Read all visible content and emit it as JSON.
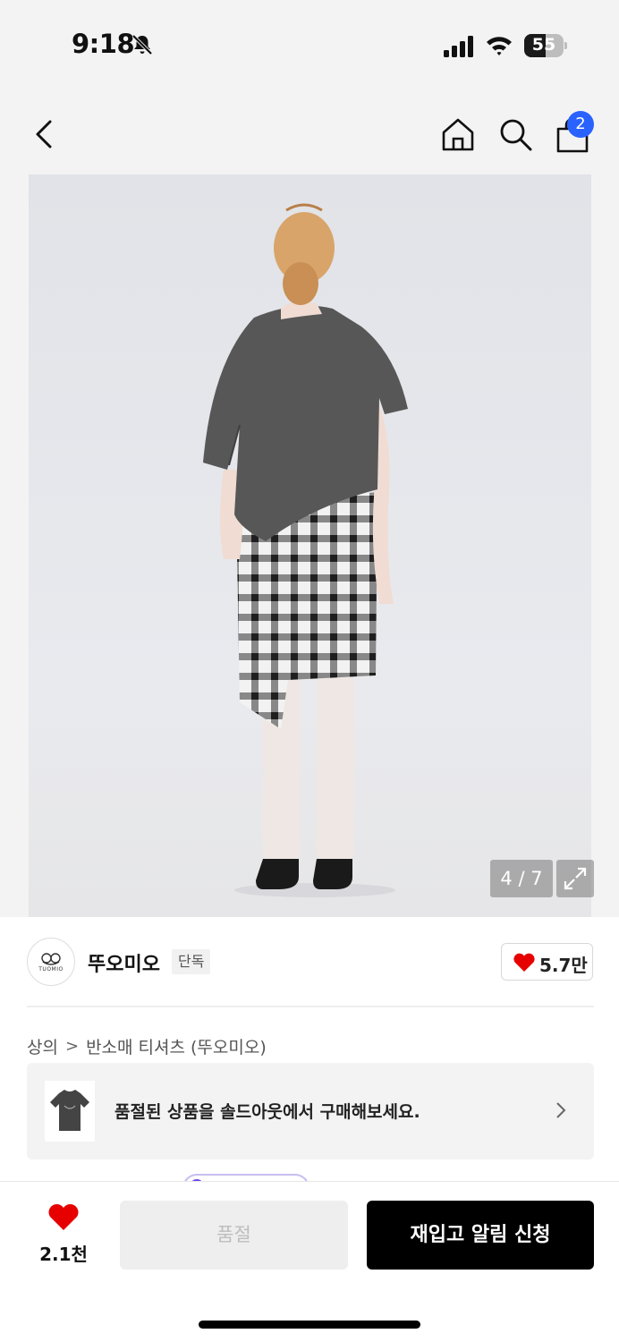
{
  "status": {
    "time": "9:18",
    "battery_level": "55",
    "battery_fraction": 0.55
  },
  "header": {
    "cart_count": "2"
  },
  "gallery": {
    "counter": "4 / 7"
  },
  "brand": {
    "name": "뚜오미오",
    "logo_text": "TUOMIO",
    "tag": "단독",
    "likes": "5.7만"
  },
  "breadcrumb": {
    "category": "상의",
    "separator": ">",
    "subcategory": "반소매 티셔츠 (뚜오미오)"
  },
  "soldout_banner": {
    "message": "품절된 상품을 솔드아웃에서 구매해보세요."
  },
  "bottom_bar": {
    "wish_count": "2.1천",
    "soldout_label": "품절",
    "restock_label": "재입고 알림 신청"
  },
  "colors": {
    "accent_blue": "#2962ff",
    "heart_red": "#e60000",
    "primary_black": "#000000",
    "soldout_bg": "#eeeeee"
  }
}
